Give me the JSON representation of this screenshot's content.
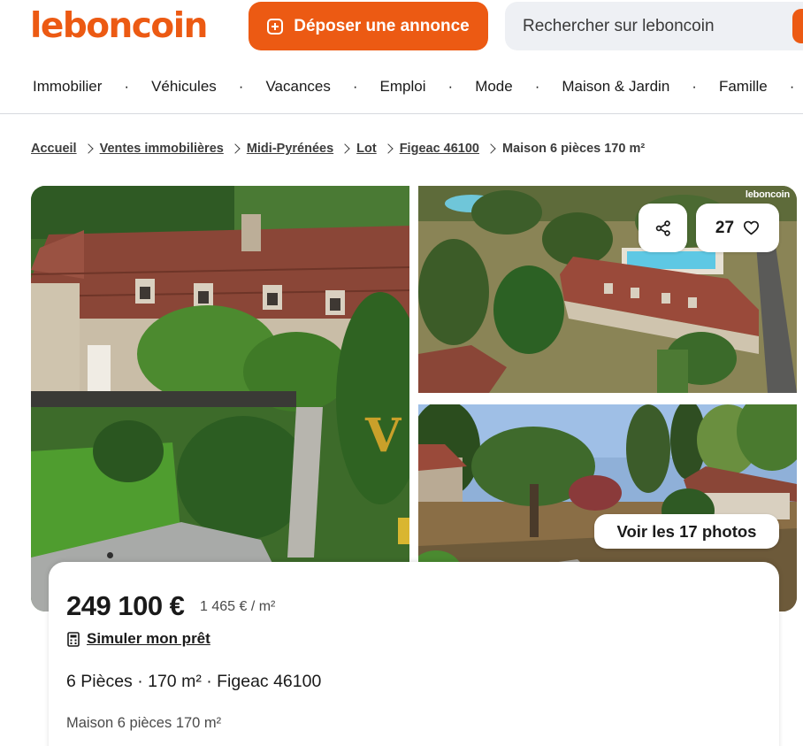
{
  "header": {
    "logo": "leboncoin",
    "deposit_label": "Déposer une annonce",
    "search_placeholder": "Rechercher sur leboncoin"
  },
  "categories": [
    "Immobilier",
    "Véhicules",
    "Vacances",
    "Emploi",
    "Mode",
    "Maison & Jardin",
    "Famille"
  ],
  "breadcrumb": {
    "items": [
      "Accueil",
      "Ventes immobilières",
      "Midi-Pyrénées",
      "Lot",
      "Figeac 46100"
    ],
    "current": "Maison 6 pièces 170 m²"
  },
  "gallery": {
    "watermark": "leboncoin",
    "favorites_count": "27",
    "photos_button": "Voir les 17 photos",
    "share_icon": "share-icon",
    "heart_icon": "heart-icon"
  },
  "listing": {
    "price": "249 100 €",
    "price_per_m2": "1 465 € / m²",
    "loan_label": "Simuler mon prêt",
    "specs": "6 Pièces · 170 m² · Figeac 46100",
    "subtitle": "Maison 6 pièces 170 m²"
  },
  "colors": {
    "brand": "#ec5a13",
    "search_bg": "#eef0f4",
    "text": "#1a1a1a"
  }
}
